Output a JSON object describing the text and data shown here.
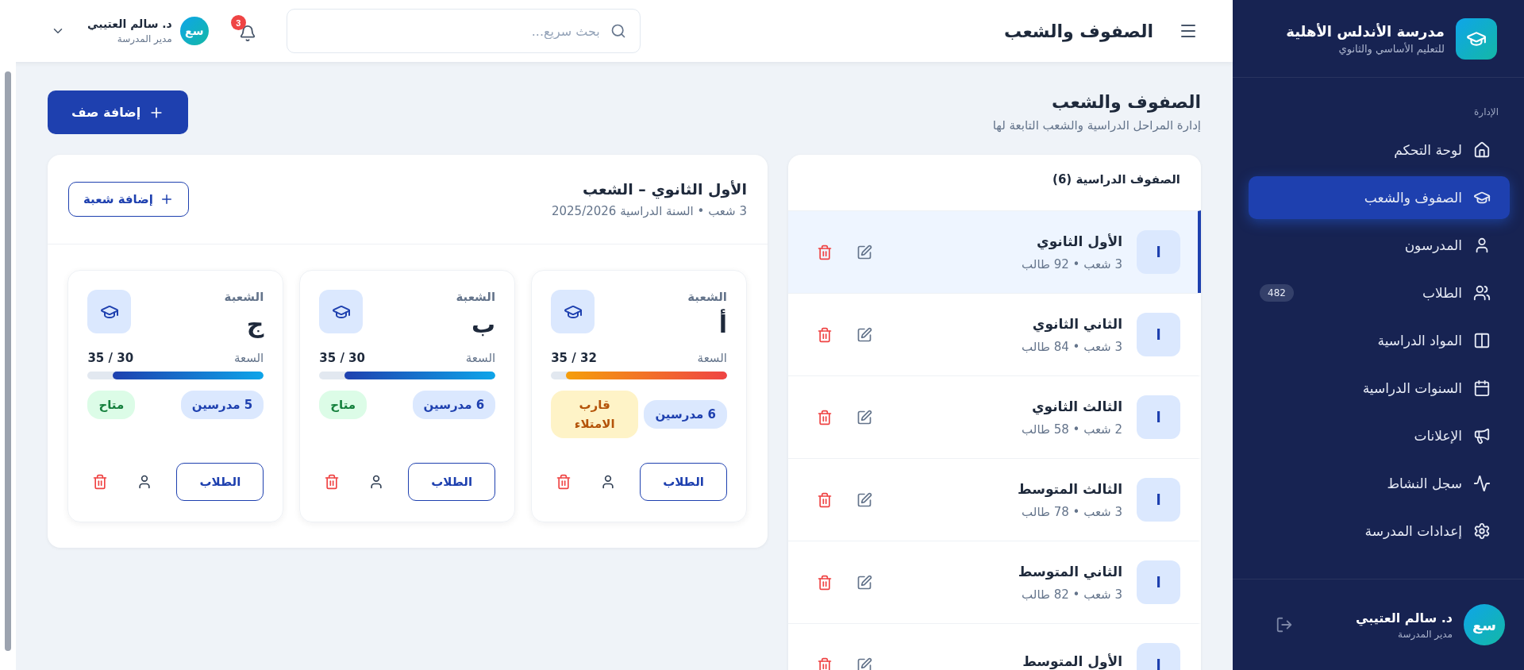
{
  "sidebar": {
    "brand": {
      "name": "مدرسة الأندلس الأهلية",
      "subtitle": "للتعليم الأساسي والثانوي"
    },
    "section_label": "الإدارة",
    "items": [
      {
        "label": "لوحة التحكم",
        "selected": false
      },
      {
        "label": "الصفوف والشعب",
        "selected": true
      },
      {
        "label": "المدرسون",
        "selected": false
      },
      {
        "label": "الطلاب",
        "selected": false,
        "badge": "482"
      },
      {
        "label": "المواد الدراسية",
        "selected": false
      },
      {
        "label": "السنوات الدراسية",
        "selected": false
      },
      {
        "label": "الإعلانات",
        "selected": false
      },
      {
        "label": "سجل النشاط",
        "selected": false
      },
      {
        "label": "إعدادات المدرسة",
        "selected": false
      }
    ],
    "user": {
      "initials": "سع",
      "name": "د. سالم العتيبي",
      "role": "مدير المدرسة"
    }
  },
  "header": {
    "title": "الصفوف والشعب",
    "search": {
      "placeholder": "بحث سريع..."
    },
    "notifications": "3",
    "user": {
      "initials": "سع",
      "name": "د. سالم العتيبي",
      "role": "مدير المدرسة"
    }
  },
  "page": {
    "title": "الصفوف والشعب",
    "subtitle": "إدارة المراحل الدراسية والشعب التابعة لها",
    "add_button": "إضافة صف"
  },
  "classes": {
    "title": "الصفوف الدراسية (6)",
    "items": [
      {
        "initial": "ا",
        "name": "الأول الثانوي",
        "meta": "3 شعب • 92 طالب",
        "selected": true
      },
      {
        "initial": "ا",
        "name": "الثاني الثانوي",
        "meta": "3 شعب • 84 طالب",
        "selected": false
      },
      {
        "initial": "ا",
        "name": "الثالث الثانوي",
        "meta": "2 شعب • 58 طالب",
        "selected": false
      },
      {
        "initial": "ا",
        "name": "الثالث المتوسط",
        "meta": "3 شعب • 78 طالب",
        "selected": false
      },
      {
        "initial": "ا",
        "name": "الثاني المتوسط",
        "meta": "3 شعب • 82 طالب",
        "selected": false
      },
      {
        "initial": "ا",
        "name": "الأول المتوسط",
        "selected": false
      }
    ]
  },
  "sections": {
    "title": "الأول الثانوي – الشعب",
    "meta": "3 شعب • السنة الدراسية 2025/2026",
    "add_button": "إضافة شعبة",
    "cards": [
      {
        "label": "الشعبة",
        "name": "أ",
        "capacity_label": "السعة",
        "capacity": "32 / 35",
        "level": 0.914,
        "teachers": "6 مدرسين",
        "status": {
          "kind": "near_full",
          "label": "قارب الامتلاء"
        },
        "students_button": "الطلاب"
      },
      {
        "label": "الشعبة",
        "name": "ب",
        "capacity_label": "السعة",
        "capacity": "30 / 35",
        "level": 0.857,
        "teachers": "6 مدرسين",
        "status": {
          "kind": "available",
          "label": "متاح"
        },
        "students_button": "الطلاب"
      },
      {
        "label": "الشعبة",
        "name": "ج",
        "capacity_label": "السعة",
        "capacity": "30 / 35",
        "level": 0.857,
        "teachers": "5 مدرسين",
        "status": {
          "kind": "available",
          "label": "متاح"
        },
        "students_button": "الطلاب"
      }
    ]
  }
}
